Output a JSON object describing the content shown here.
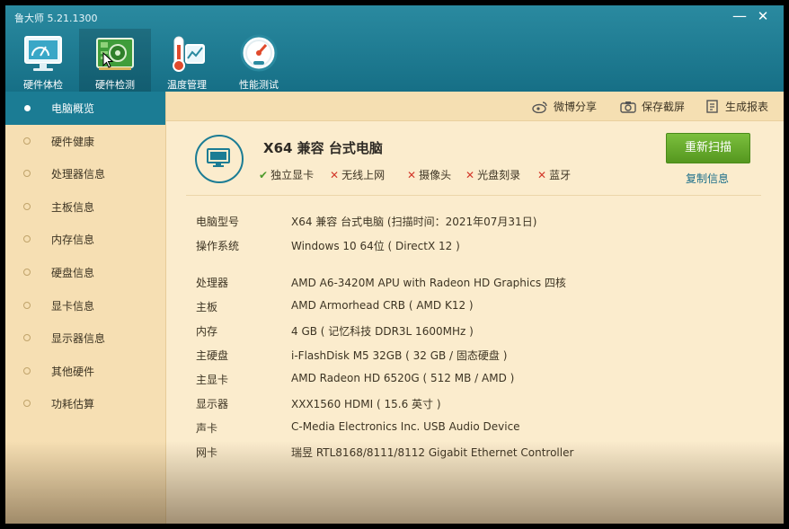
{
  "app": {
    "title": "鲁大师 5.21.1300"
  },
  "window_controls": {
    "minimize": "—",
    "close": "✕"
  },
  "nav_tabs": [
    {
      "label": "硬件体检",
      "icon": "monitor-chart-icon"
    },
    {
      "label": "硬件检测",
      "icon": "circuit-board-icon",
      "active": true
    },
    {
      "label": "温度管理",
      "icon": "thermometer-icon"
    },
    {
      "label": "性能测试",
      "icon": "speedometer-icon"
    }
  ],
  "sidebar": {
    "items": [
      {
        "label": "电脑概览",
        "active": true
      },
      {
        "label": "硬件健康"
      },
      {
        "label": "处理器信息"
      },
      {
        "label": "主板信息"
      },
      {
        "label": "内存信息"
      },
      {
        "label": "硬盘信息"
      },
      {
        "label": "显卡信息"
      },
      {
        "label": "显示器信息"
      },
      {
        "label": "其他硬件"
      },
      {
        "label": "功耗估算"
      }
    ]
  },
  "toolbar": {
    "weibo_share": "微博分享",
    "save_screenshot": "保存截屏",
    "generate_report": "生成报表"
  },
  "summary": {
    "title": "X64 兼容 台式电脑",
    "features": [
      {
        "label": "独立显卡",
        "ok": true,
        "mark": "✔"
      },
      {
        "label": "无线上网",
        "ok": false,
        "mark": "✕"
      },
      {
        "label": "摄像头",
        "ok": false,
        "mark": "✕"
      },
      {
        "label": "光盘刻录",
        "ok": false,
        "mark": "✕"
      },
      {
        "label": "蓝牙",
        "ok": false,
        "mark": "✕"
      }
    ],
    "rescan_button": "重新扫描",
    "copy_info": "复制信息"
  },
  "info_rows": [
    {
      "key": "电脑型号",
      "value": "X64 兼容 台式电脑 (扫描时间：2021年07月31日)"
    },
    {
      "key": "操作系统",
      "value": "Windows 10 64位 ( DirectX 12 )"
    },
    {
      "key": "处理器",
      "value": "AMD A6-3420M APU with Radeon HD Graphics 四核"
    },
    {
      "key": "主板",
      "value": "AMD Armorhead CRB ( AMD K12 )"
    },
    {
      "key": "内存",
      "value": "4 GB ( 记忆科技 DDR3L 1600MHz )"
    },
    {
      "key": "主硬盘",
      "value": " i-FlashDisk M5 32GB ( 32 GB / 固态硬盘 )"
    },
    {
      "key": "主显卡",
      "value": "AMD Radeon HD 6520G ( 512 MB / AMD )"
    },
    {
      "key": "显示器",
      "value": "XXX1560 HDMI ( 15.6 英寸 )"
    },
    {
      "key": "声卡",
      "value": "C-Media Electronics Inc. USB Audio Device"
    },
    {
      "key": "网卡",
      "value": "瑞昱 RTL8168/8111/8112 Gigabit Ethernet Controller"
    }
  ],
  "colors": {
    "header": "#1b7c94",
    "accent_green": "#5fa52a",
    "check_green": "#4c9a2a",
    "cross_red": "#d3392b",
    "background": "#fbeccd"
  }
}
